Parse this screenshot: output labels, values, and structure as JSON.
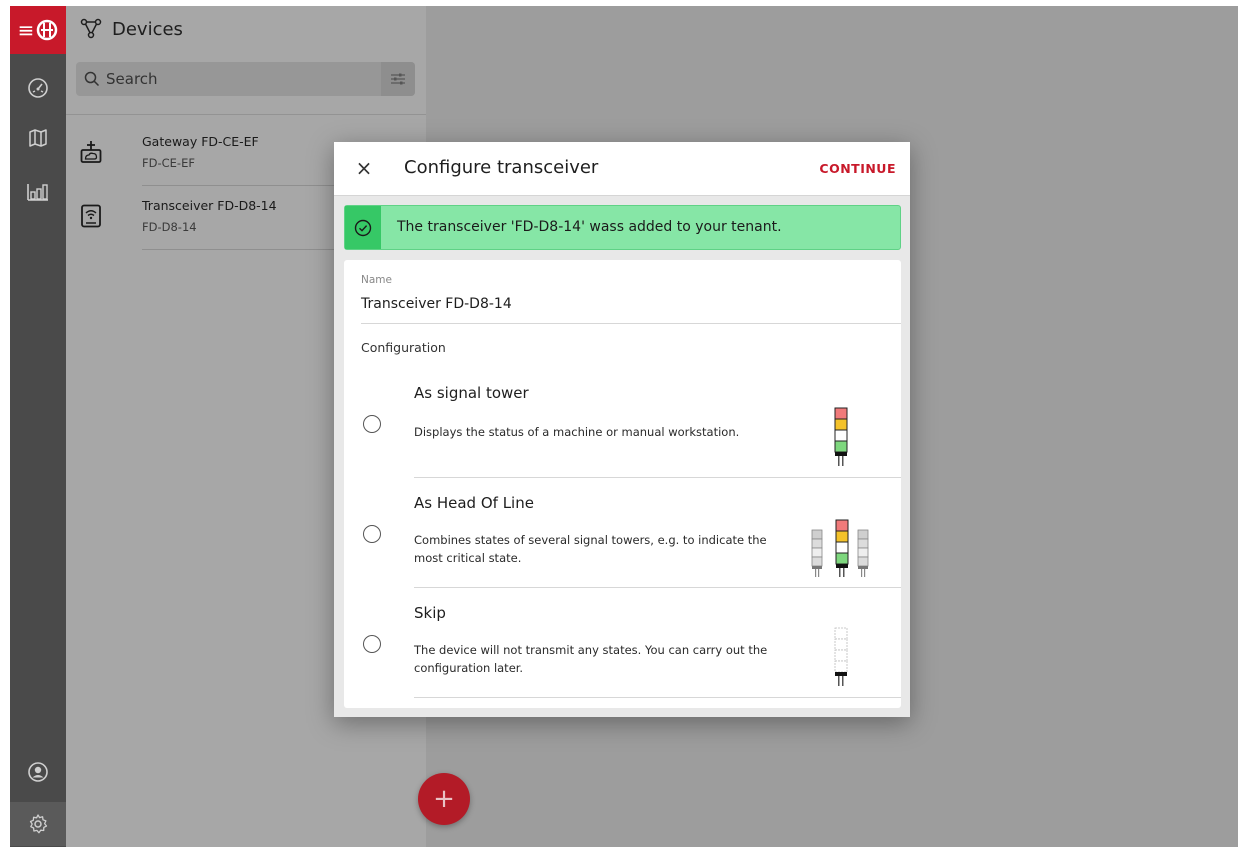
{
  "sidebar": {
    "logo": "≡",
    "nav": [
      {
        "icon": "dashboard-gauge-icon"
      },
      {
        "icon": "map-icon"
      },
      {
        "icon": "statistics-icon"
      }
    ],
    "bottom": [
      {
        "icon": "account-icon"
      },
      {
        "icon": "settings-gear-icon"
      }
    ]
  },
  "devices_panel": {
    "title": "Devices",
    "search_placeholder": "Search",
    "devices": [
      {
        "name": "Gateway FD-CE-EF",
        "id": "FD-CE-EF",
        "icon": "gateway-icon"
      },
      {
        "name": "Transceiver FD-D8-14",
        "id": "FD-D8-14",
        "icon": "transceiver-icon"
      }
    ],
    "add_button": "+"
  },
  "dialog": {
    "title": "Configure transceiver",
    "close": "×",
    "continue_label": "CONTINUE",
    "alert_text": "The transceiver 'FD-D8-14' wass added to your tenant.",
    "name_label": "Name",
    "name_value": "Transceiver FD-D8-14",
    "config_label": "Configuration",
    "options": [
      {
        "title": "As signal tower",
        "desc": "Displays the status of a machine or manual workstation.",
        "selected": false
      },
      {
        "title": "As Head Of Line",
        "desc": "Combines states of several signal towers, e.g. to indicate the most critical state.",
        "selected": false
      },
      {
        "title": "Skip",
        "desc": "The device will not transmit any states. You can carry out the configuration later.",
        "selected": false
      }
    ]
  },
  "colors": {
    "brand_red": "#c8192a",
    "success_green": "#36c866",
    "alert_bg": "#86e6a6",
    "tower_red": "#f07a7a",
    "tower_yellow": "#f4c22a",
    "tower_green": "#7ed77e"
  }
}
